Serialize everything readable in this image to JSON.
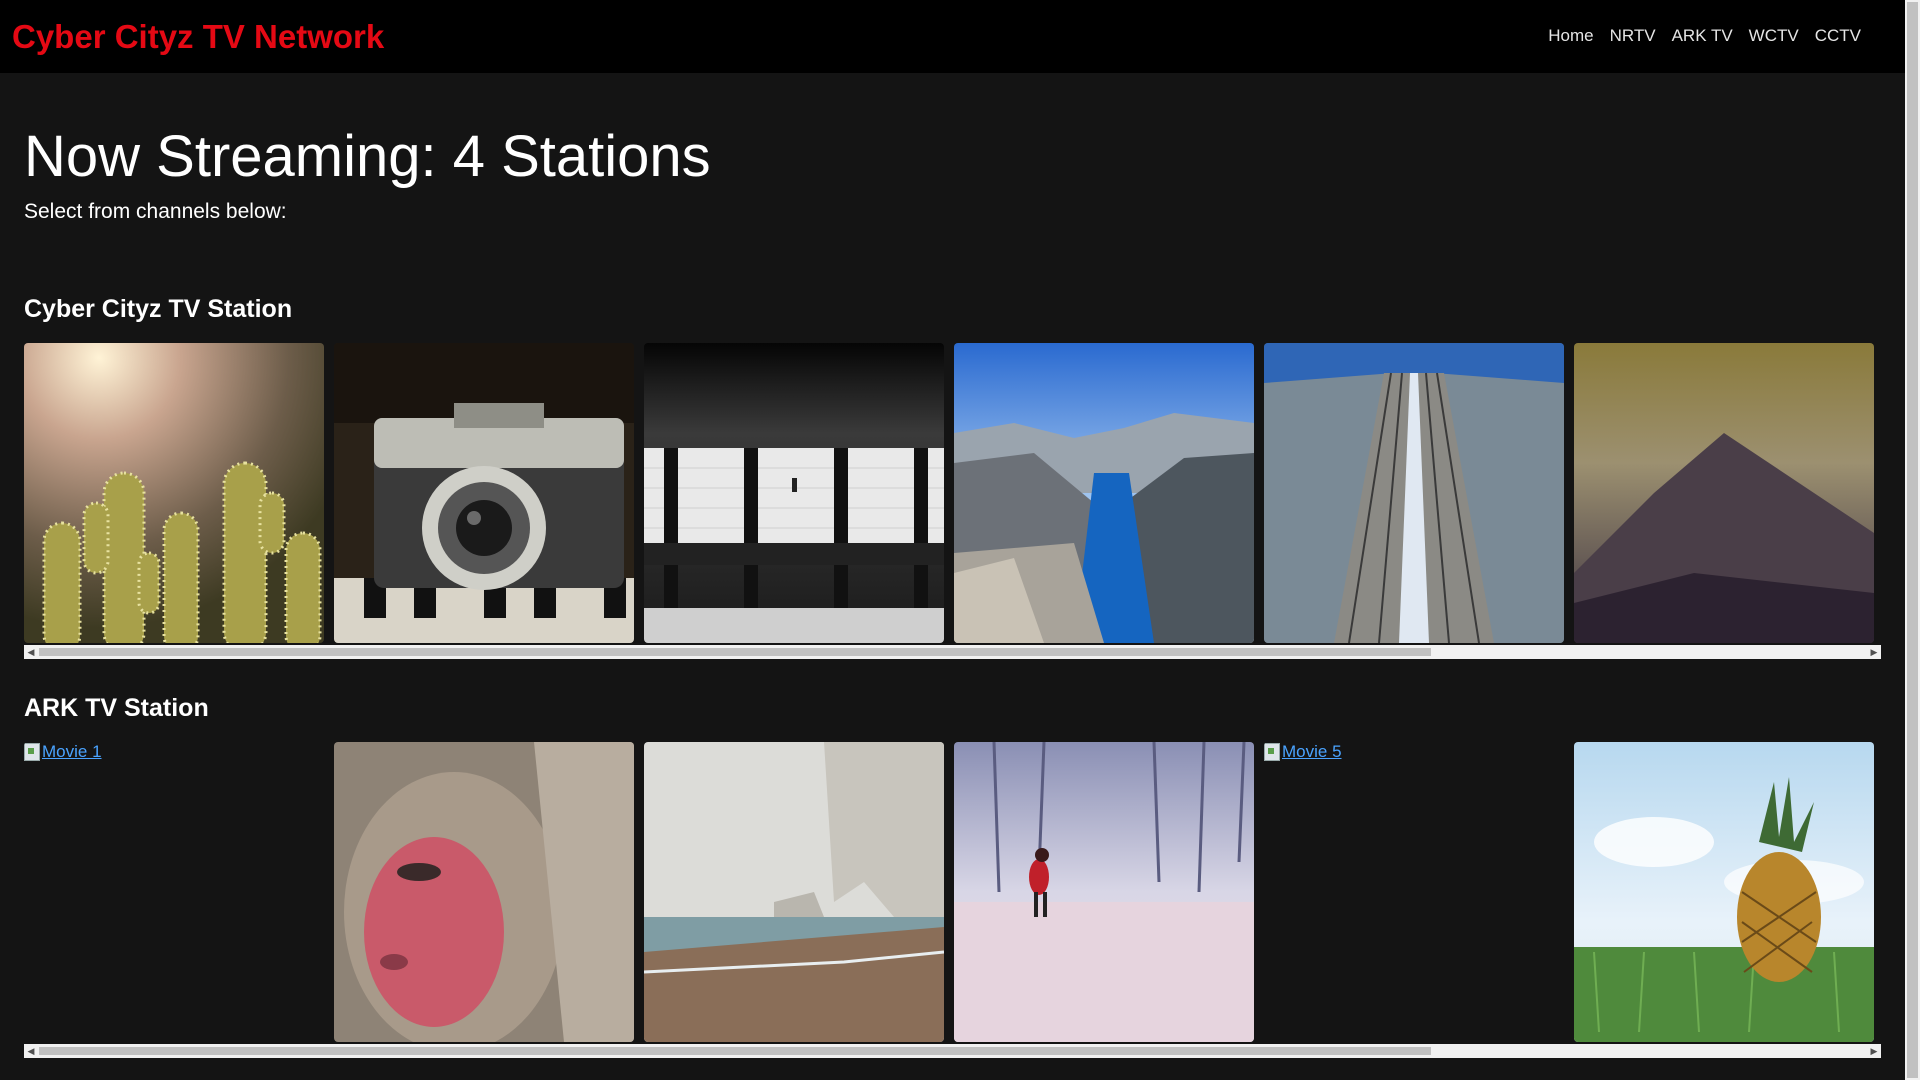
{
  "navbar": {
    "brand": "Cyber Cityz TV Network",
    "links": [
      "Home",
      "NRTV",
      "ARK TV",
      "WCTV",
      "CCTV"
    ]
  },
  "hero": {
    "title": "Now Streaming: 4 Stations",
    "subtitle": "Select from channels below:"
  },
  "sections": [
    {
      "title": "Cyber Cityz TV Station",
      "tiles": [
        {
          "subject": "cactus at sunset"
        },
        {
          "subject": "vintage camera"
        },
        {
          "subject": "subway platform"
        },
        {
          "subject": "fjord cliff"
        },
        {
          "subject": "railway tracks"
        },
        {
          "subject": "misty mountain"
        }
      ]
    },
    {
      "title": "ARK TV Station",
      "tiles": [
        {
          "broken_alt": "Movie 1"
        },
        {
          "subject": "snow monkey"
        },
        {
          "subject": "foggy chalk cliffs beach"
        },
        {
          "subject": "person in red coat in snow"
        },
        {
          "broken_alt": "Movie 5"
        },
        {
          "subject": "pineapple on grass"
        }
      ]
    }
  ],
  "colors": {
    "brand": "#e50914",
    "background": "#141414",
    "navbar": "#000000",
    "link": "#4aa3ff"
  }
}
